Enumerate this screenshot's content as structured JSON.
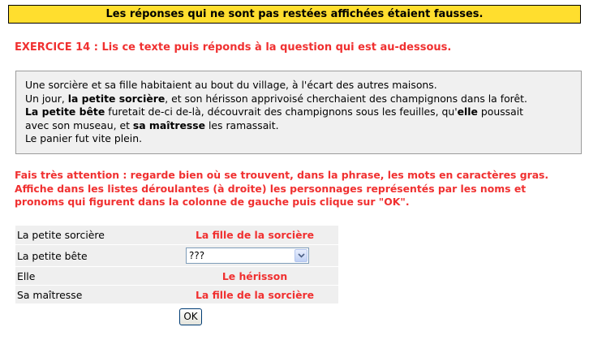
{
  "banner": {
    "text": "Les réponses qui ne sont pas restées affichées étaient fausses."
  },
  "exercise": {
    "title": "EXERCICE 14 : Lis ce texte puis réponds à la question qui est au-dessous."
  },
  "story": {
    "l1": "Une sorcière et sa fille habitaient au bout du village, à l'écart des autres maisons.",
    "l2_a": "Un jour, ",
    "l2_b": "la petite sorcière",
    "l2_c": ", et son hérisson apprivoisé cherchaient des champignons dans la forêt.",
    "l3_a": "La petite bête",
    "l3_b": " furetait de-ci de-là, découvrait des champignons sous les feuilles, qu'",
    "l3_c": "elle",
    "l3_d": " poussait",
    "l4_a": "avec son museau, et ",
    "l4_b": "sa maîtresse",
    "l4_c": " les ramassait.",
    "l5": "Le panier fut vite plein."
  },
  "instructions": {
    "l1": "Fais très attention : regarde bien où se trouvent, dans la phrase, les mots en caractères gras.",
    "l2": "Affiche dans les listes déroulantes (à droite) les personnages représentés par les noms et",
    "l3": "pronoms qui figurent dans la colonne de gauche puis clique sur \"OK\"."
  },
  "rows": [
    {
      "name": "La petite sorcière",
      "answer": "La fille de la sorcière"
    },
    {
      "name": "La petite bête",
      "select_value": "???"
    },
    {
      "name": "Elle",
      "answer": "Le hérisson"
    },
    {
      "name": "Sa maîtresse",
      "answer": "La fille de la sorcière"
    }
  ],
  "ok_button": {
    "label": "OK"
  },
  "colors": {
    "banner_bg": "#ffde2e",
    "accent_red": "#f03030",
    "row_bg": "#efefef"
  },
  "icons": {
    "dropdown": "chevron-down-icon"
  }
}
